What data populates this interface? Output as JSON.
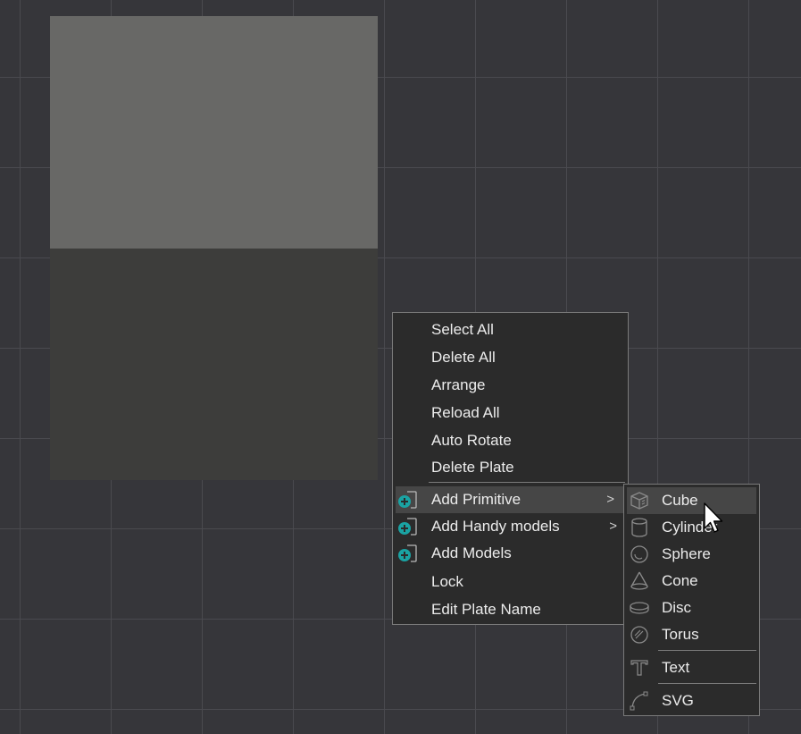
{
  "context_menu": {
    "items": [
      {
        "label": "Select All"
      },
      {
        "label": "Delete All"
      },
      {
        "label": "Arrange"
      },
      {
        "label": "Reload All"
      },
      {
        "label": "Auto Rotate"
      },
      {
        "label": "Delete Plate"
      },
      {
        "label": "Add Primitive",
        "icon": "add-icon",
        "submenu": true
      },
      {
        "label": "Add Handy models",
        "icon": "add-icon",
        "submenu": true
      },
      {
        "label": "Add Models",
        "icon": "add-icon"
      },
      {
        "label": "Lock"
      },
      {
        "label": "Edit Plate Name"
      }
    ],
    "arrow_glyph": ">"
  },
  "primitive_submenu": {
    "items": [
      {
        "label": "Cube",
        "icon": "cube-icon"
      },
      {
        "label": "Cylinder",
        "icon": "cylinder-icon"
      },
      {
        "label": "Sphere",
        "icon": "sphere-icon"
      },
      {
        "label": "Cone",
        "icon": "cone-icon"
      },
      {
        "label": "Disc",
        "icon": "disc-icon"
      },
      {
        "label": "Torus",
        "icon": "torus-icon"
      },
      {
        "label": "Text",
        "icon": "text-icon"
      },
      {
        "label": "SVG",
        "icon": "svg-icon"
      }
    ]
  },
  "colors": {
    "background": "#36363a",
    "grid_line": "#4a4a4f",
    "plate_top": "#686866",
    "plate_bottom": "#3d3d3b",
    "menu_bg": "#2b2b2b",
    "menu_hover": "#464646",
    "accent_teal": "#1aa3a3"
  }
}
